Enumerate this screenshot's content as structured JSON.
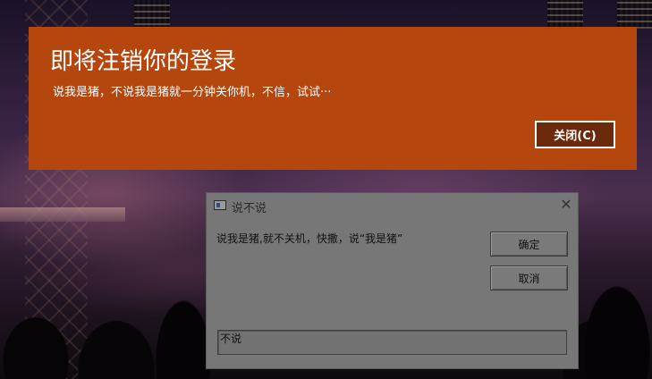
{
  "notification": {
    "title": "即将注销你的登录",
    "message": "说我是猪，不说我是猪就一分钟关你机，不信，试试···",
    "close_label": "关闭(C)",
    "background": "#b5470e"
  },
  "dialog": {
    "title": "说不说",
    "prompt": "说我是猪,就不关机，快撒，说“我是猪”",
    "ok_label": "确定",
    "cancel_label": "取消",
    "input_value": "不说",
    "icons": {
      "app": "window-icon",
      "close": "close-icon"
    }
  }
}
